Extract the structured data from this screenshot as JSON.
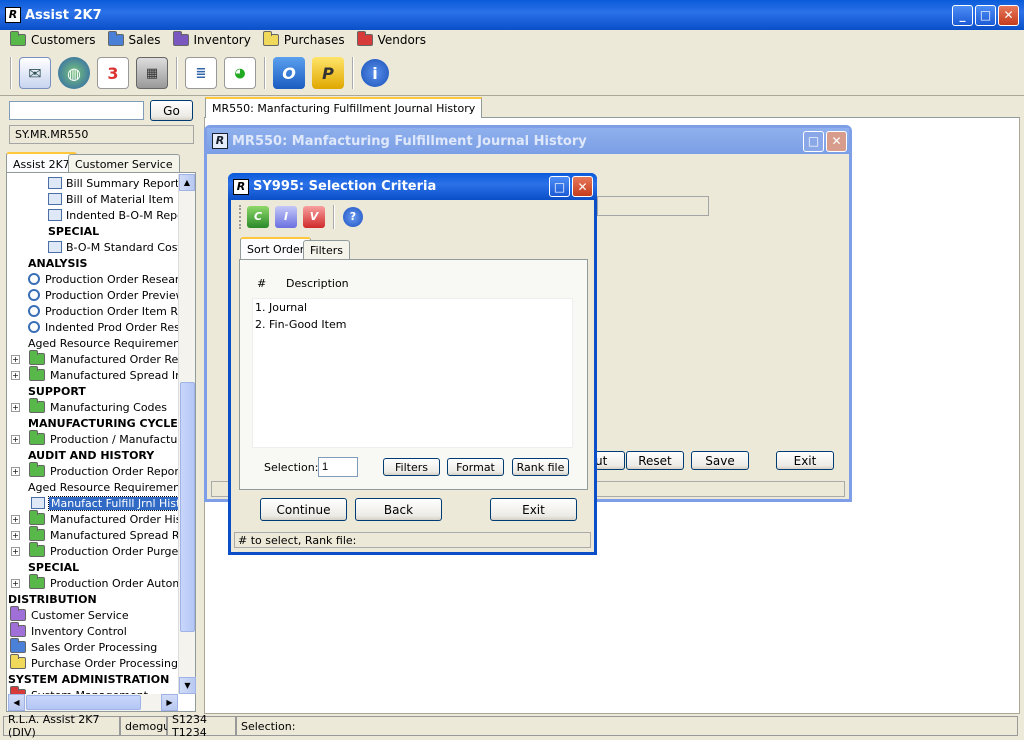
{
  "app": {
    "title": "Assist 2K7",
    "logo": "R"
  },
  "menu": [
    {
      "label": "Customers",
      "color": "#58b84a"
    },
    {
      "label": "Sales",
      "color": "#4a80d8"
    },
    {
      "label": "Inventory",
      "color": "#7a58c0"
    },
    {
      "label": "Purchases",
      "color": "#f0d85a"
    },
    {
      "label": "Vendors",
      "color": "#d83a3a"
    }
  ],
  "toolbar": {
    "icons": [
      "mail-icon",
      "globe-icon",
      "calendar-icon",
      "calculator-icon",
      "report-icon",
      "chart-report-icon",
      "outlook-icon",
      "p-icon",
      "info-icon"
    ]
  },
  "search": {
    "value": "",
    "go_label": "Go",
    "path": "SY.MR.MR550"
  },
  "lefttabs": [
    "Assist 2K7",
    "Customer Service"
  ],
  "tree": [
    {
      "label": "Bill Summary Report",
      "type": "rep",
      "indent": 2
    },
    {
      "label": "Bill of Material Item Rep",
      "type": "rep",
      "indent": 2
    },
    {
      "label": "Indented B-O-M Repor",
      "type": "rep",
      "indent": 2
    },
    {
      "label": "SPECIAL",
      "type": "bold",
      "indent": 2
    },
    {
      "label": "B-O-M Standard Cost F",
      "type": "rep",
      "indent": 2
    },
    {
      "label": "ANALYSIS",
      "type": "bold",
      "indent": 1
    },
    {
      "label": "Production Order Research",
      "type": "mag",
      "indent": 1
    },
    {
      "label": "Production Order Preview",
      "type": "mag",
      "indent": 1
    },
    {
      "label": "Production Order Item Res",
      "type": "mag",
      "indent": 1
    },
    {
      "label": "Indented Prod Order Resea",
      "type": "mag",
      "indent": 1
    },
    {
      "label": "Aged Resource Requirements",
      "type": "plain",
      "indent": 1
    },
    {
      "label": "Manufactured Order Resea",
      "type": "folder",
      "indent": 1
    },
    {
      "label": "Manufactured Spread Inqu",
      "type": "folder",
      "indent": 1
    },
    {
      "label": "SUPPORT",
      "type": "bold",
      "indent": 1
    },
    {
      "label": "Manufacturing Codes",
      "type": "folder",
      "indent": 1
    },
    {
      "label": "MANUFACTURING CYCLE",
      "type": "bold",
      "indent": 1
    },
    {
      "label": "Production / Manufacturing",
      "type": "folder",
      "indent": 1
    },
    {
      "label": "AUDIT AND HISTORY",
      "type": "bold",
      "indent": 1
    },
    {
      "label": "Production Order Reports",
      "type": "folder",
      "indent": 1
    },
    {
      "label": "Aged Resource Requirements F",
      "type": "plain",
      "indent": 1
    },
    {
      "label": "Manufact Fulfill Jrnl History",
      "type": "sel",
      "indent": 1
    },
    {
      "label": "Manufactured Order Hist R",
      "type": "folder",
      "indent": 1
    },
    {
      "label": "Manufactured Spread Repo",
      "type": "folder",
      "indent": 1
    },
    {
      "label": "Production Order Purges",
      "type": "folder",
      "indent": 1
    },
    {
      "label": "SPECIAL",
      "type": "bold",
      "indent": 1
    },
    {
      "label": "Production Order Automati",
      "type": "folder",
      "indent": 1
    },
    {
      "label": "DISTRIBUTION",
      "type": "bold",
      "indent": 0
    },
    {
      "label": "Customer Service",
      "type": "folder-p",
      "indent": 0
    },
    {
      "label": "Inventory Control",
      "type": "folder-p",
      "indent": 0
    },
    {
      "label": "Sales Order Processing",
      "type": "folder-b",
      "indent": 0
    },
    {
      "label": "Purchase Order Processing",
      "type": "folder-y",
      "indent": 0
    },
    {
      "label": "SYSTEM ADMINISTRATION",
      "type": "bold",
      "indent": 0
    },
    {
      "label": "System Management",
      "type": "folder-r",
      "indent": 0
    }
  ],
  "doctab": "MR550: Manfacturing Fulfillment Journal History",
  "mr550": {
    "title": "MR550: Manfacturing Fulfillment Journal History",
    "buttons": {
      "out": "ut",
      "reset": "Reset",
      "save": "Save",
      "exit": "Exit"
    }
  },
  "sy995": {
    "title": "SY995: Selection Criteria",
    "tabs": [
      "Sort Order",
      "Filters"
    ],
    "col_num": "#",
    "col_desc": "Description",
    "rows": [
      {
        "num": "1.",
        "desc": "Journal"
      },
      {
        "num": "2.",
        "desc": "Fin-Good Item"
      }
    ],
    "selection_label": "Selection:",
    "selection_value": "1",
    "filters": "Filters",
    "format": "Format",
    "rankfile": "Rank file",
    "continue": "Continue",
    "back": "Back",
    "exit": "Exit",
    "status": "# to select,  Rank file:"
  },
  "statusbar": [
    "R.L.A. Assist 2K7 (DIV)",
    "demogui",
    "S1234 T1234",
    "Selection:"
  ]
}
